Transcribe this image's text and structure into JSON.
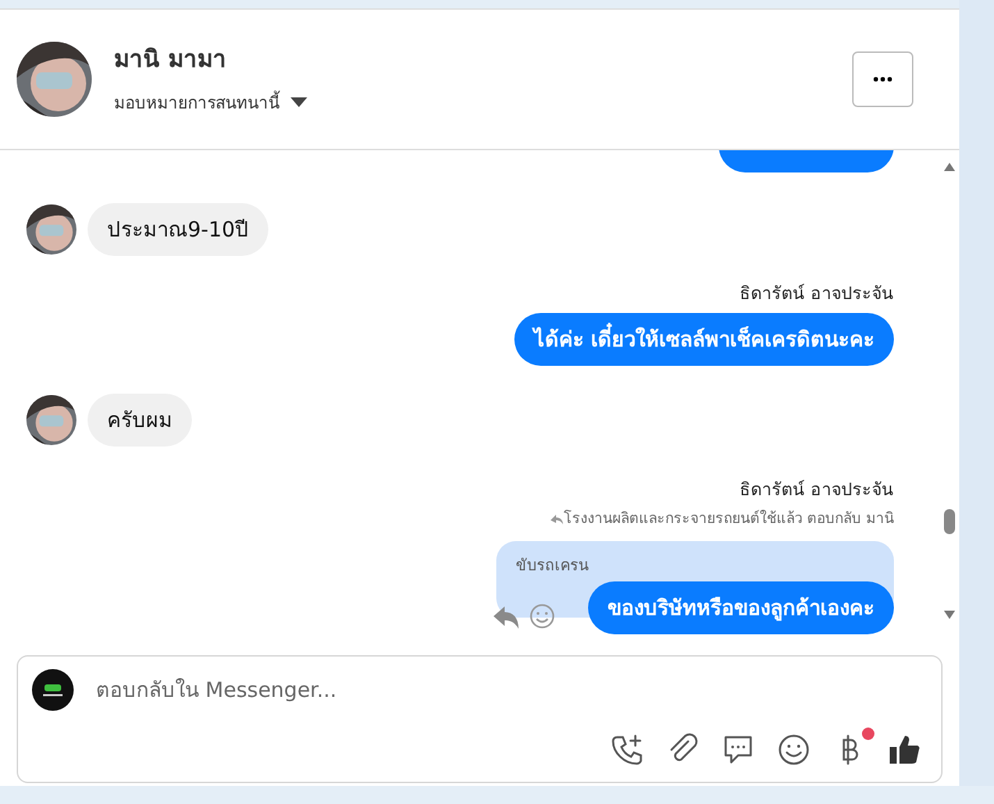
{
  "contact": {
    "name": "มานิ มามา",
    "assign_label": "มอบหมายการสนทนานี้"
  },
  "messages": [
    {
      "kind": "partial"
    },
    {
      "kind": "incoming",
      "text": "ประมาณ9-10ปี"
    },
    {
      "kind": "outgoing",
      "sender": "ธิดารัตน์ อาจประจัน",
      "text": "ได้ค่ะ เดี๋ยวให้เซลล์พาเช็คเครดิตนะคะ"
    },
    {
      "kind": "incoming",
      "text": "ครับผม"
    },
    {
      "kind": "reply",
      "sender": "ธิดารัตน์ อาจประจัน",
      "reply_note": "โรงงานผลิตและกระจายรถยนต์ใช้แล้ว ตอบกลับ มานิ",
      "quoted": "ขับรถเครน",
      "text": "ของบริษัทหรือของลูกค้าเองคะ"
    }
  ],
  "composer": {
    "placeholder": "ตอบกลับใน Messenger...",
    "payment_notification": true
  }
}
